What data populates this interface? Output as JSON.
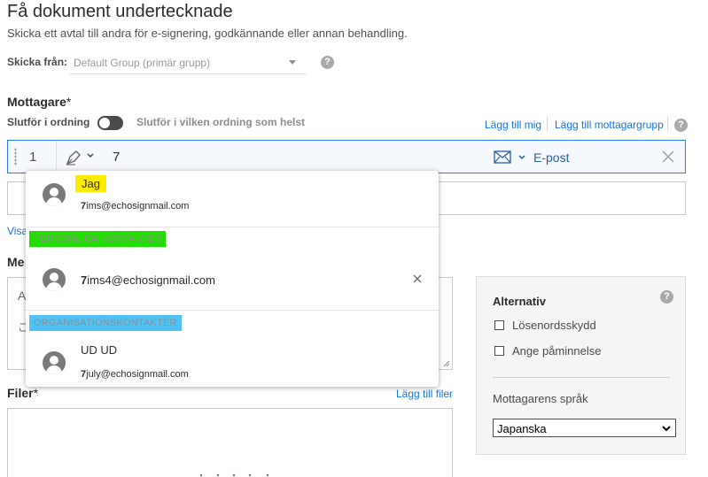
{
  "header": {
    "title": "Få dokument undertecknade",
    "subtitle": "Skicka ett avtal till andra för e-signering, godkännande eller annan behandling."
  },
  "send_from": {
    "label": "Skicka från:",
    "value": "Default Group (primär grupp)"
  },
  "recipients": {
    "label": "Mottagare",
    "required_mark": "*",
    "order_label": "Slutför i ordning",
    "any_order_label": "Slutför i vilken ordning som helst",
    "add_me": "Lägg till mig",
    "add_group": "Lägg till mottagargrupp",
    "row": {
      "index": "1",
      "typed_value": "7",
      "role_icon": "pen-sign-icon",
      "auth_icon": "envelope-icon",
      "auth_method": "E-post"
    },
    "show_link": "Visa"
  },
  "autocomplete": {
    "self_contact": {
      "name": "Jag",
      "email_prefix": "7",
      "email_rest": "ims@echosignmail.com",
      "highlight": "#ffeb00"
    },
    "personal_header": {
      "label": "PERSONLIGA KONTAKTER",
      "highlight": "#22dd00"
    },
    "personal_contact": {
      "email_prefix": "7",
      "email_rest": "ims4@echosignmail.com"
    },
    "org_header": {
      "label": "ORGANISATIONSKONTAKTER",
      "highlight": "#4fc3f7"
    },
    "org_contact": {
      "name": "UD UD",
      "email_prefix": "7",
      "email_rest": "july@echosignmail.com"
    }
  },
  "message": {
    "label_partial": "Me",
    "field_initial": "A",
    "body_initial": "こ"
  },
  "files": {
    "label": "Filer",
    "required_mark": "*",
    "add_files": "Lägg till filer"
  },
  "options": {
    "title": "Alternativ",
    "password_protection": "Lösenordsskydd",
    "set_reminder": "Ange påminnelse",
    "language_label": "Mottagarens språk",
    "language_value": "Japanska"
  },
  "colors": {
    "accent": "#1473e6",
    "active_border": "#2680eb"
  }
}
